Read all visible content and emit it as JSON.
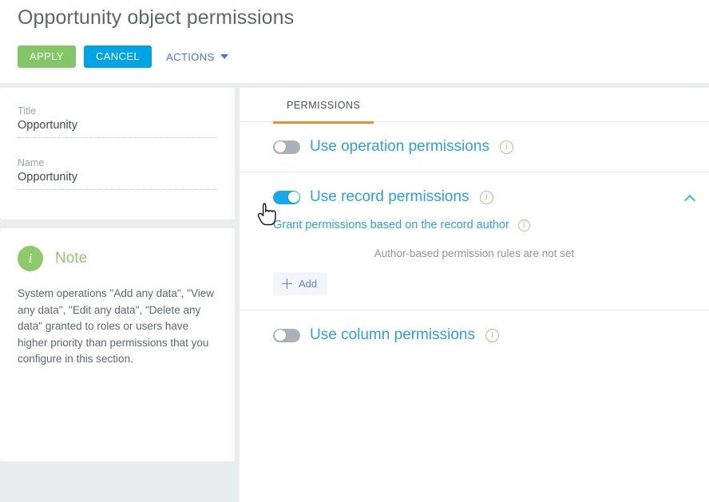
{
  "header": {
    "title": "Opportunity object permissions",
    "apply_label": "APPLY",
    "cancel_label": "CANCEL",
    "actions_label": "ACTIONS"
  },
  "sidebar": {
    "fields": [
      {
        "label": "Title",
        "value": "Opportunity"
      },
      {
        "label": "Name",
        "value": "Opportunity"
      }
    ],
    "note": {
      "badge": "i",
      "title": "Note",
      "body": "System operations \"Add any data\", \"View any data\", \"Edit any data\", \"Delete any data\" granted to roles or users have higher priority than permissions that you configure in this section."
    }
  },
  "main": {
    "tabs": [
      {
        "label": "PERMISSIONS",
        "active": true
      }
    ],
    "permissions": [
      {
        "id": "operation",
        "label": "Use operation permissions",
        "toggle_state": "off",
        "info": "i"
      },
      {
        "id": "record",
        "label": "Use record permissions",
        "toggle_state": "on",
        "info": "i",
        "collapse_icon": "chevron-up",
        "sub_label": "Grant permissions based on the record author",
        "sub_info": "i",
        "empty_message": "Author-based permission rules are not set",
        "add_label": "Add"
      },
      {
        "id": "column",
        "label": "Use column permissions",
        "toggle_state": "off",
        "info": "i"
      }
    ]
  },
  "colors": {
    "apply_green": "#82c667",
    "cancel_blue": "#00a4e4",
    "actions_blue": "#4a76c8",
    "tab_accent": "#f08c35",
    "toggle_on": "#17a8e8",
    "toggle_off": "#a9b2b8",
    "link_blue": "#2f9fe0",
    "note_green": "#8ec96c",
    "page_bg": "#e9edee"
  }
}
